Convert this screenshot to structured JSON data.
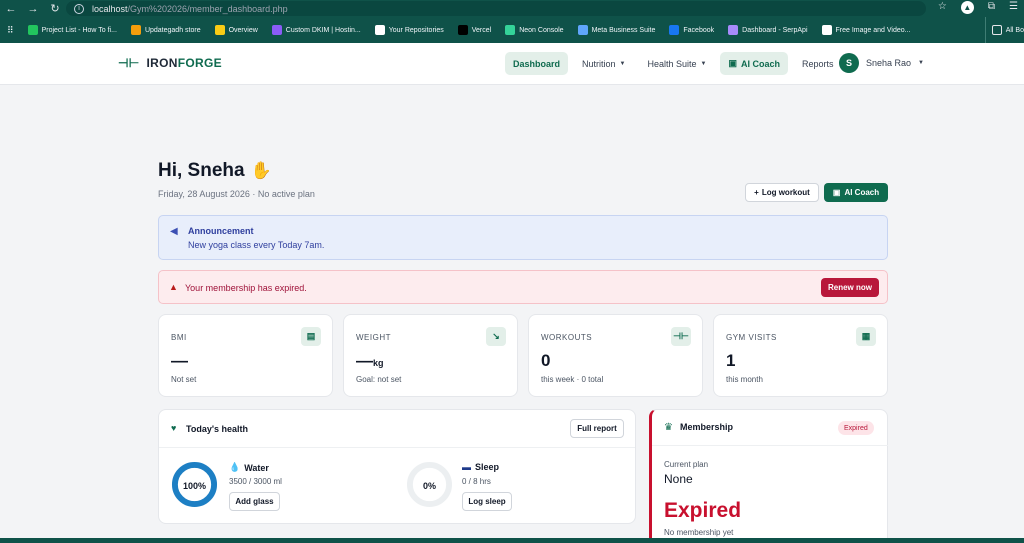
{
  "browser": {
    "url_host": "localhost",
    "url_path": "/Gym%202026/member_dashboard.php",
    "bookmarks": [
      {
        "label": "Project List - How To fi...",
        "color": "#22c55e"
      },
      {
        "label": "Updategadh store",
        "color": "#f59e0b"
      },
      {
        "label": "Overview",
        "color": "#facc15"
      },
      {
        "label": "Custom DKIM | Hostin...",
        "color": "#8b5cf6"
      },
      {
        "label": "Your Repositories",
        "color": "#ffffff"
      },
      {
        "label": "Vercel",
        "color": "#000000"
      },
      {
        "label": "Neon Console",
        "color": "#34d399"
      },
      {
        "label": "Meta Business Suite",
        "color": "#60a5fa"
      },
      {
        "label": "Facebook",
        "color": "#1877f2"
      },
      {
        "label": "Dashboard - SerpApi",
        "color": "#a78bfa"
      },
      {
        "label": "Free Image and Video...",
        "color": "#ffffff"
      }
    ],
    "all_bookmarks_label": "All Bo"
  },
  "app": {
    "brand_part1": "IRON",
    "brand_part2": "FORGE",
    "nav": {
      "dashboard": "Dashboard",
      "nutrition": "Nutrition",
      "health_suite": "Health Suite",
      "ai_coach": "AI Coach",
      "reports": "Reports"
    },
    "user": {
      "initial": "S",
      "name": "Sneha Rao"
    }
  },
  "greeting": {
    "title": "Hi, Sneha",
    "subline": "Friday, 28 August 2026 · No active plan",
    "log_workout": "Log workout",
    "ai_coach": "AI Coach"
  },
  "announcement": {
    "title": "Announcement",
    "message": "New yoga class every Today 7am."
  },
  "alert": {
    "message": "Your membership has expired.",
    "button": "Renew now"
  },
  "stats": [
    {
      "label": "BMI",
      "value": "—",
      "unit": "",
      "sub": "Not set"
    },
    {
      "label": "WEIGHT",
      "value": "—",
      "unit": "kg",
      "sub": "Goal: not set"
    },
    {
      "label": "WORKOUTS",
      "value": "0",
      "unit": "",
      "sub": "this week · 0 total"
    },
    {
      "label": "GYM VISITS",
      "value": "1",
      "unit": "",
      "sub": "this month"
    }
  ],
  "health": {
    "title": "Today's health",
    "full_report": "Full report",
    "water": {
      "title": "Water",
      "value": "3500 / 3000 ml",
      "percent_label": "100%",
      "fraction": 1.0,
      "button": "Add glass",
      "color": "#1d7fc4"
    },
    "sleep": {
      "title": "Sleep",
      "value": "0 / 8 hrs",
      "percent_label": "0%",
      "fraction": 0.0,
      "button": "Log sleep",
      "color": "#6366f1"
    }
  },
  "membership": {
    "title": "Membership",
    "badge": "Expired",
    "current_plan_label": "Current plan",
    "current_plan": "None",
    "status": "Expired",
    "note": "No membership yet"
  },
  "colors": {
    "brand": "#0f6b4f",
    "danger": "#b8173a",
    "chrome": "#0f5249"
  }
}
